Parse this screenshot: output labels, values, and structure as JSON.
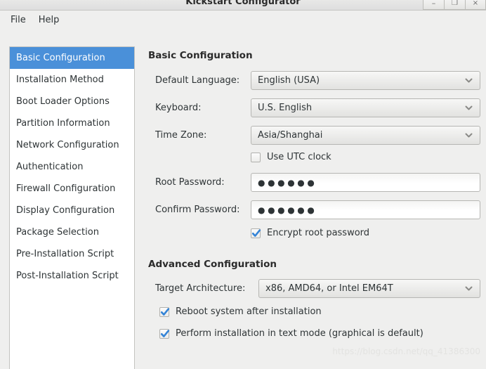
{
  "window": {
    "title": "Kickstart Configurator",
    "controls": [
      {
        "name": "minimize",
        "glyph": "–"
      },
      {
        "name": "maximize",
        "glyph": "❐"
      },
      {
        "name": "close",
        "glyph": "×"
      }
    ]
  },
  "menubar": {
    "items": [
      {
        "label": "File"
      },
      {
        "label": "Help"
      }
    ]
  },
  "sidebar": {
    "items": [
      {
        "label": "Basic Configuration",
        "selected": true
      },
      {
        "label": "Installation Method",
        "selected": false
      },
      {
        "label": "Boot Loader Options",
        "selected": false
      },
      {
        "label": "Partition Information",
        "selected": false
      },
      {
        "label": "Network Configuration",
        "selected": false
      },
      {
        "label": "Authentication",
        "selected": false
      },
      {
        "label": "Firewall Configuration",
        "selected": false
      },
      {
        "label": "Display Configuration",
        "selected": false
      },
      {
        "label": "Package Selection",
        "selected": false
      },
      {
        "label": "Pre-Installation Script",
        "selected": false
      },
      {
        "label": "Post-Installation Script",
        "selected": false
      }
    ]
  },
  "basic": {
    "heading": "Basic Configuration",
    "default_language": {
      "label": "Default Language:",
      "value": "English (USA)"
    },
    "keyboard": {
      "label": "Keyboard:",
      "value": "U.S. English"
    },
    "time_zone": {
      "label": "Time Zone:",
      "value": "Asia/Shanghai"
    },
    "use_utc": {
      "label": "Use UTC clock",
      "checked": false
    },
    "root_password": {
      "label": "Root Password:",
      "value": "●●●●●●"
    },
    "confirm_password": {
      "label": "Confirm Password:",
      "value": "●●●●●●"
    },
    "encrypt_root": {
      "label": "Encrypt root password",
      "checked": true
    }
  },
  "advanced": {
    "heading": "Advanced Configuration",
    "target_architecture": {
      "label": "Target Architecture:",
      "value": "x86, AMD64, or Intel EM64T"
    },
    "reboot_after_install": {
      "label": "Reboot system after installation",
      "checked": true
    },
    "text_mode_install": {
      "label": "Perform installation in text mode (graphical is default)",
      "checked": true
    }
  },
  "watermark": {
    "text": "https://blog.csdn.net/qq_41386300"
  },
  "colors": {
    "selection_blue": "#4a90d9",
    "checkmark_blue": "#3584d6",
    "window_bg": "#efefee",
    "list_bg": "#ffffff",
    "text": "#2e3436"
  }
}
